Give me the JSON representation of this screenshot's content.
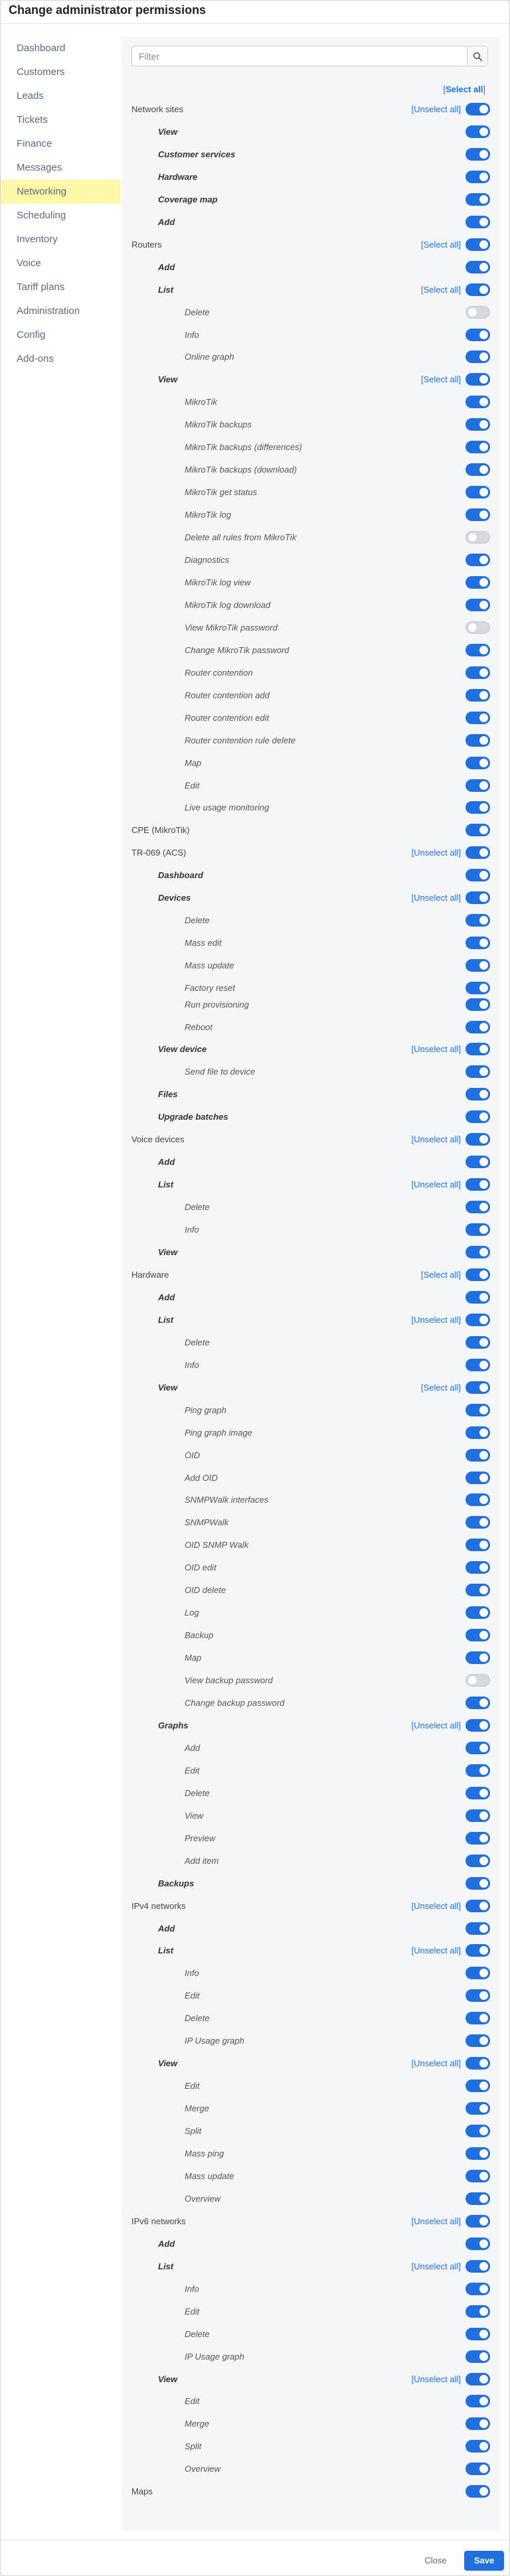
{
  "title": "Change administrator permissions",
  "sidebar": [
    {
      "label": "Dashboard"
    },
    {
      "label": "Customers"
    },
    {
      "label": "Leads"
    },
    {
      "label": "Tickets"
    },
    {
      "label": "Finance"
    },
    {
      "label": "Messages"
    },
    {
      "label": "Networking",
      "active": true
    },
    {
      "label": "Scheduling"
    },
    {
      "label": "Inventory"
    },
    {
      "label": "Voice"
    },
    {
      "label": "Tariff plans"
    },
    {
      "label": "Administration"
    },
    {
      "label": "Config"
    },
    {
      "label": "Add-ons"
    }
  ],
  "filter": {
    "placeholder": "Filter",
    "value": ""
  },
  "select_all_label": "Select all",
  "permissions": [
    {
      "label": "Network sites",
      "level": 0,
      "sel": "Unselect all",
      "on": true
    },
    {
      "label": "View",
      "level": 1,
      "on": true
    },
    {
      "label": "Customer services",
      "level": 1,
      "on": true
    },
    {
      "label": "Hardware",
      "level": 1,
      "on": true
    },
    {
      "label": "Coverage map",
      "level": 1,
      "on": true
    },
    {
      "label": "Add",
      "level": 1,
      "on": true
    },
    {
      "label": "Routers",
      "level": 0,
      "sel": "Select all",
      "on": true
    },
    {
      "label": "Add",
      "level": 1,
      "on": true
    },
    {
      "label": "List",
      "level": 1,
      "sel": "Select all",
      "on": true
    },
    {
      "label": "Delete",
      "level": 2,
      "on": false
    },
    {
      "label": "Info",
      "level": 2,
      "on": true
    },
    {
      "label": "Online graph",
      "level": 2,
      "on": true
    },
    {
      "label": "View",
      "level": 1,
      "sel": "Select all",
      "on": true
    },
    {
      "label": "MikroTik",
      "level": 2,
      "on": true
    },
    {
      "label": "MikroTik backups",
      "level": 2,
      "on": true
    },
    {
      "label": "MikroTik backups (differences)",
      "level": 2,
      "on": true
    },
    {
      "label": "MikroTik backups (download)",
      "level": 2,
      "on": true
    },
    {
      "label": "MikroTik get status",
      "level": 2,
      "on": true
    },
    {
      "label": "MikroTik log",
      "level": 2,
      "on": true
    },
    {
      "label": "Delete all rules from MikroTik",
      "level": 2,
      "on": false
    },
    {
      "label": "Diagnostics",
      "level": 2,
      "on": true
    },
    {
      "label": "MikroTik log view",
      "level": 2,
      "on": true
    },
    {
      "label": "MikroTik log download",
      "level": 2,
      "on": true
    },
    {
      "label": "View MikroTik password",
      "level": 2,
      "on": false
    },
    {
      "label": "Change MikroTik password",
      "level": 2,
      "on": true
    },
    {
      "label": "Router contention",
      "level": 2,
      "on": true
    },
    {
      "label": "Router contention add",
      "level": 2,
      "on": true
    },
    {
      "label": "Router contention edit",
      "level": 2,
      "on": true
    },
    {
      "label": "Router contention rule delete",
      "level": 2,
      "on": true
    },
    {
      "label": "Map",
      "level": 2,
      "on": true
    },
    {
      "label": "Edit",
      "level": 2,
      "on": true
    },
    {
      "label": "Live usage monitoring",
      "level": 2,
      "on": true
    },
    {
      "label": "CPE (MikroTik)",
      "level": 0,
      "on": true
    },
    {
      "label": "TR-069 (ACS)",
      "level": 0,
      "sel": "Unselect all",
      "on": true
    },
    {
      "label": "Dashboard",
      "level": 1,
      "on": true
    },
    {
      "label": "Devices",
      "level": 1,
      "sel": "Unselect all",
      "on": true
    },
    {
      "label": "Delete",
      "level": 2,
      "on": true
    },
    {
      "label": "Mass edit",
      "level": 2,
      "on": true
    },
    {
      "label": "Mass update",
      "level": 2,
      "on": true
    },
    {
      "label": "Factory reset",
      "level": 2,
      "on": true,
      "compact": true
    },
    {
      "label": "Run provisioning",
      "level": 2,
      "on": true
    },
    {
      "label": "Reboot",
      "level": 2,
      "on": true
    },
    {
      "label": "View device",
      "level": 1,
      "sel": "Unselect all",
      "on": true
    },
    {
      "label": "Send file to device",
      "level": 2,
      "on": true
    },
    {
      "label": "Files",
      "level": 1,
      "on": true
    },
    {
      "label": "Upgrade batches",
      "level": 1,
      "on": true
    },
    {
      "label": "Voice devices",
      "level": 0,
      "sel": "Unselect all",
      "on": true
    },
    {
      "label": "Add",
      "level": 1,
      "on": true
    },
    {
      "label": "List",
      "level": 1,
      "sel": "Unselect all",
      "on": true
    },
    {
      "label": "Delete",
      "level": 2,
      "on": true
    },
    {
      "label": "Info",
      "level": 2,
      "on": true
    },
    {
      "label": "View",
      "level": 1,
      "on": true
    },
    {
      "label": "Hardware",
      "level": 0,
      "sel": "Select all",
      "on": true
    },
    {
      "label": "Add",
      "level": 1,
      "on": true
    },
    {
      "label": "List",
      "level": 1,
      "sel": "Unselect all",
      "on": true
    },
    {
      "label": "Delete",
      "level": 2,
      "on": true
    },
    {
      "label": "Info",
      "level": 2,
      "on": true
    },
    {
      "label": "View",
      "level": 1,
      "sel": "Select all",
      "on": true
    },
    {
      "label": "Ping graph",
      "level": 2,
      "on": true
    },
    {
      "label": "Ping graph image",
      "level": 2,
      "on": true
    },
    {
      "label": "OID",
      "level": 2,
      "on": true
    },
    {
      "label": "Add OID",
      "level": 2,
      "on": true
    },
    {
      "label": "SNMPWalk interfaces",
      "level": 2,
      "on": true
    },
    {
      "label": "SNMPWalk",
      "level": 2,
      "on": true
    },
    {
      "label": "OID SNMP Walk",
      "level": 2,
      "on": true
    },
    {
      "label": "OID edit",
      "level": 2,
      "on": true
    },
    {
      "label": "OID delete",
      "level": 2,
      "on": true
    },
    {
      "label": "Log",
      "level": 2,
      "on": true
    },
    {
      "label": "Backup",
      "level": 2,
      "on": true
    },
    {
      "label": "Map",
      "level": 2,
      "on": true
    },
    {
      "label": "View backup password",
      "level": 2,
      "on": false
    },
    {
      "label": "Change backup password",
      "level": 2,
      "on": true
    },
    {
      "label": "Graphs",
      "level": 1,
      "sel": "Unselect all",
      "on": true
    },
    {
      "label": "Add",
      "level": 2,
      "on": true
    },
    {
      "label": "Edit",
      "level": 2,
      "on": true
    },
    {
      "label": "Delete",
      "level": 2,
      "on": true
    },
    {
      "label": "View",
      "level": 2,
      "on": true
    },
    {
      "label": "Preview",
      "level": 2,
      "on": true
    },
    {
      "label": "Add item",
      "level": 2,
      "on": true
    },
    {
      "label": "Backups",
      "level": 1,
      "on": true
    },
    {
      "label": "IPv4 networks",
      "level": 0,
      "sel": "Unselect all",
      "on": true
    },
    {
      "label": "Add",
      "level": 1,
      "on": true
    },
    {
      "label": "List",
      "level": 1,
      "sel": "Unselect all",
      "on": true
    },
    {
      "label": "Info",
      "level": 2,
      "on": true
    },
    {
      "label": "Edit",
      "level": 2,
      "on": true
    },
    {
      "label": "Delete",
      "level": 2,
      "on": true
    },
    {
      "label": "IP Usage graph",
      "level": 2,
      "on": true
    },
    {
      "label": "View",
      "level": 1,
      "sel": "Unselect all",
      "on": true
    },
    {
      "label": "Edit",
      "level": 2,
      "on": true
    },
    {
      "label": "Merge",
      "level": 2,
      "on": true
    },
    {
      "label": "Split",
      "level": 2,
      "on": true
    },
    {
      "label": "Mass ping",
      "level": 2,
      "on": true
    },
    {
      "label": "Mass update",
      "level": 2,
      "on": true
    },
    {
      "label": "Overview",
      "level": 2,
      "on": true
    },
    {
      "label": "IPv6 networks",
      "level": 0,
      "sel": "Unselect all",
      "on": true
    },
    {
      "label": "Add",
      "level": 1,
      "on": true
    },
    {
      "label": "List",
      "level": 1,
      "sel": "Unselect all",
      "on": true
    },
    {
      "label": "Info",
      "level": 2,
      "on": true
    },
    {
      "label": "Edit",
      "level": 2,
      "on": true
    },
    {
      "label": "Delete",
      "level": 2,
      "on": true
    },
    {
      "label": "IP Usage graph",
      "level": 2,
      "on": true
    },
    {
      "label": "View",
      "level": 1,
      "sel": "Unselect all",
      "on": true
    },
    {
      "label": "Edit",
      "level": 2,
      "on": true
    },
    {
      "label": "Merge",
      "level": 2,
      "on": true
    },
    {
      "label": "Split",
      "level": 2,
      "on": true
    },
    {
      "label": "Overview",
      "level": 2,
      "on": true
    },
    {
      "label": "Maps",
      "level": 0,
      "on": true
    }
  ],
  "footer": {
    "close_label": "Close",
    "save_label": "Save"
  },
  "colors": {
    "accent": "#1f6fde",
    "link": "#1a73e8",
    "active_nav": "#fff7a8"
  }
}
